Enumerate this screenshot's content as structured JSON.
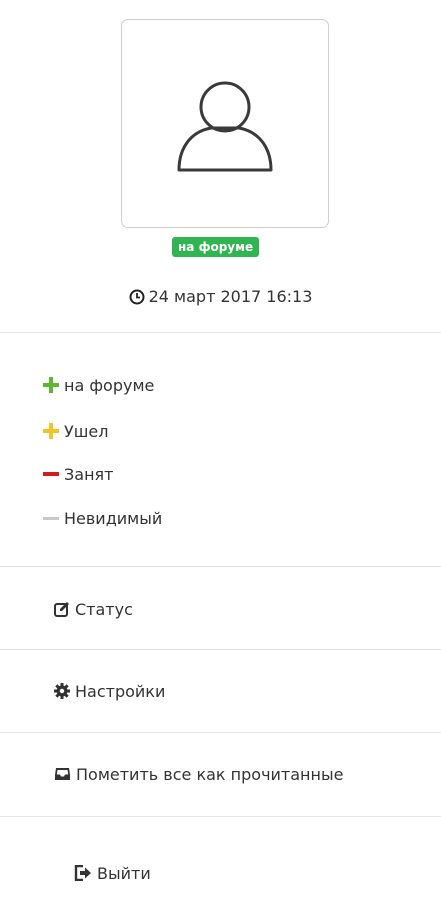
{
  "profile": {
    "online_badge": "на форуме",
    "last_seen": "24 март 2017 16:13"
  },
  "status_options": [
    {
      "label": "на форуме",
      "icon": "plus-green-icon",
      "color": "#5cb82e"
    },
    {
      "label": "Ушел",
      "icon": "plus-yellow-icon",
      "color": "#f2c425"
    },
    {
      "label": "Занят",
      "icon": "minus-red-icon",
      "color": "#d4191f"
    },
    {
      "label": "Невидимый",
      "icon": "minus-grey-icon",
      "color": "#c8c8c8"
    }
  ],
  "menu": {
    "status": "Статус",
    "settings": "Настройки",
    "mark_read": "Пометить все как прочитанные",
    "logout": "Выйти"
  },
  "colors": {
    "badge_bg": "#31b551",
    "divider": "#e3e3e3",
    "text": "#333333"
  }
}
